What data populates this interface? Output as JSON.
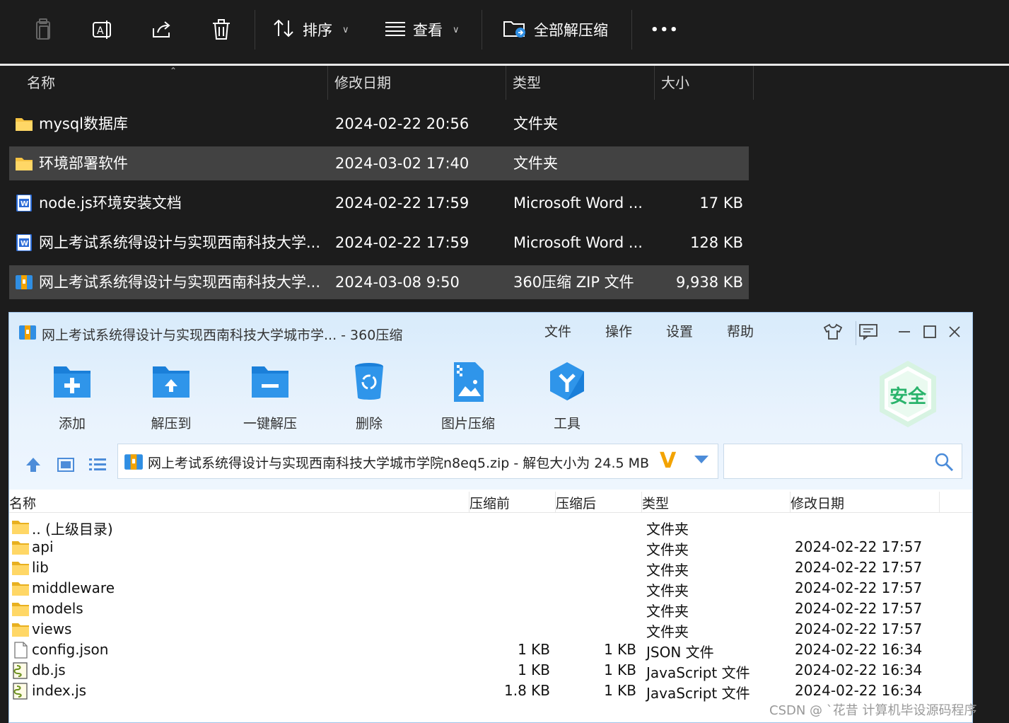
{
  "toolbar": {
    "sort_label": "排序",
    "view_label": "查看",
    "extract_all_label": "全部解压缩",
    "more_label": "•••"
  },
  "columns": {
    "name": "名称",
    "modified": "修改日期",
    "type": "类型",
    "size": "大小"
  },
  "files": [
    {
      "name": "mysql数据库",
      "date": "2024-02-22 20:56",
      "type": "文件夹",
      "size": "",
      "icon": "folder-icon"
    },
    {
      "name": "环境部署软件",
      "date": "2024-03-02 17:40",
      "type": "文件夹",
      "size": "",
      "icon": "folder-icon"
    },
    {
      "name": "node.js环境安装文档",
      "date": "2024-02-22 17:59",
      "type": "Microsoft Word ...",
      "size": "17 KB",
      "icon": "word-doc-icon"
    },
    {
      "name": "网上考试系统得设计与实现西南科技大学...",
      "date": "2024-02-22 17:59",
      "type": "Microsoft Word ...",
      "size": "128 KB",
      "icon": "word-doc-icon"
    },
    {
      "name": "网上考试系统得设计与实现西南科技大学...",
      "date": "2024-03-08 9:50",
      "type": "360压缩 ZIP 文件",
      "size": "9,938 KB",
      "icon": "zip-archive-icon"
    }
  ],
  "zip_window": {
    "title": "网上考试系统得设计与实现西南科技大学城市学... - 360压缩",
    "menu": [
      "文件",
      "操作",
      "设置",
      "帮助"
    ],
    "tools": [
      "添加",
      "解压到",
      "一键解压",
      "删除",
      "图片压缩",
      "工具"
    ],
    "badge": "安全",
    "address": "网上考试系统得设计与实现西南科技大学城市学院n8eq5.zip - 解包大小为 24.5 MB",
    "search_placeholder": "",
    "columns": {
      "name": "名称",
      "before": "压缩前",
      "after": "压缩后",
      "type": "类型",
      "modified": "修改日期"
    },
    "entries": [
      {
        "name": ".. (上级目录)",
        "before": "",
        "after": "",
        "type": "文件夹",
        "date": "",
        "icon": "folder-icon"
      },
      {
        "name": "api",
        "before": "",
        "after": "",
        "type": "文件夹",
        "date": "2024-02-22 17:57",
        "icon": "folder-icon"
      },
      {
        "name": "lib",
        "before": "",
        "after": "",
        "type": "文件夹",
        "date": "2024-02-22 17:57",
        "icon": "folder-icon"
      },
      {
        "name": "middleware",
        "before": "",
        "after": "",
        "type": "文件夹",
        "date": "2024-02-22 17:57",
        "icon": "folder-icon"
      },
      {
        "name": "models",
        "before": "",
        "after": "",
        "type": "文件夹",
        "date": "2024-02-22 17:57",
        "icon": "folder-icon"
      },
      {
        "name": "views",
        "before": "",
        "after": "",
        "type": "文件夹",
        "date": "2024-02-22 17:57",
        "icon": "folder-icon"
      },
      {
        "name": "config.json",
        "before": "1 KB",
        "after": "1 KB",
        "type": "JSON 文件",
        "date": "2024-02-22 16:34",
        "icon": "blank-file-icon"
      },
      {
        "name": "db.js",
        "before": "1 KB",
        "after": "1 KB",
        "type": "JavaScript 文件",
        "date": "2024-02-22 16:34",
        "icon": "script-file-icon"
      },
      {
        "name": "index.js",
        "before": "1.8 KB",
        "after": "1 KB",
        "type": "JavaScript 文件",
        "date": "2024-02-22 16:34",
        "icon": "script-file-icon"
      }
    ]
  },
  "watermark": "CSDN @ ˋ花昔 计算机毕设源码程序",
  "colors": {
    "explorer_bg": "#1c1c1c",
    "selected_row": "#424242",
    "folder": "#f6c343",
    "accent_blue": "#2f8ee3",
    "badge_green": "#29b36b"
  }
}
